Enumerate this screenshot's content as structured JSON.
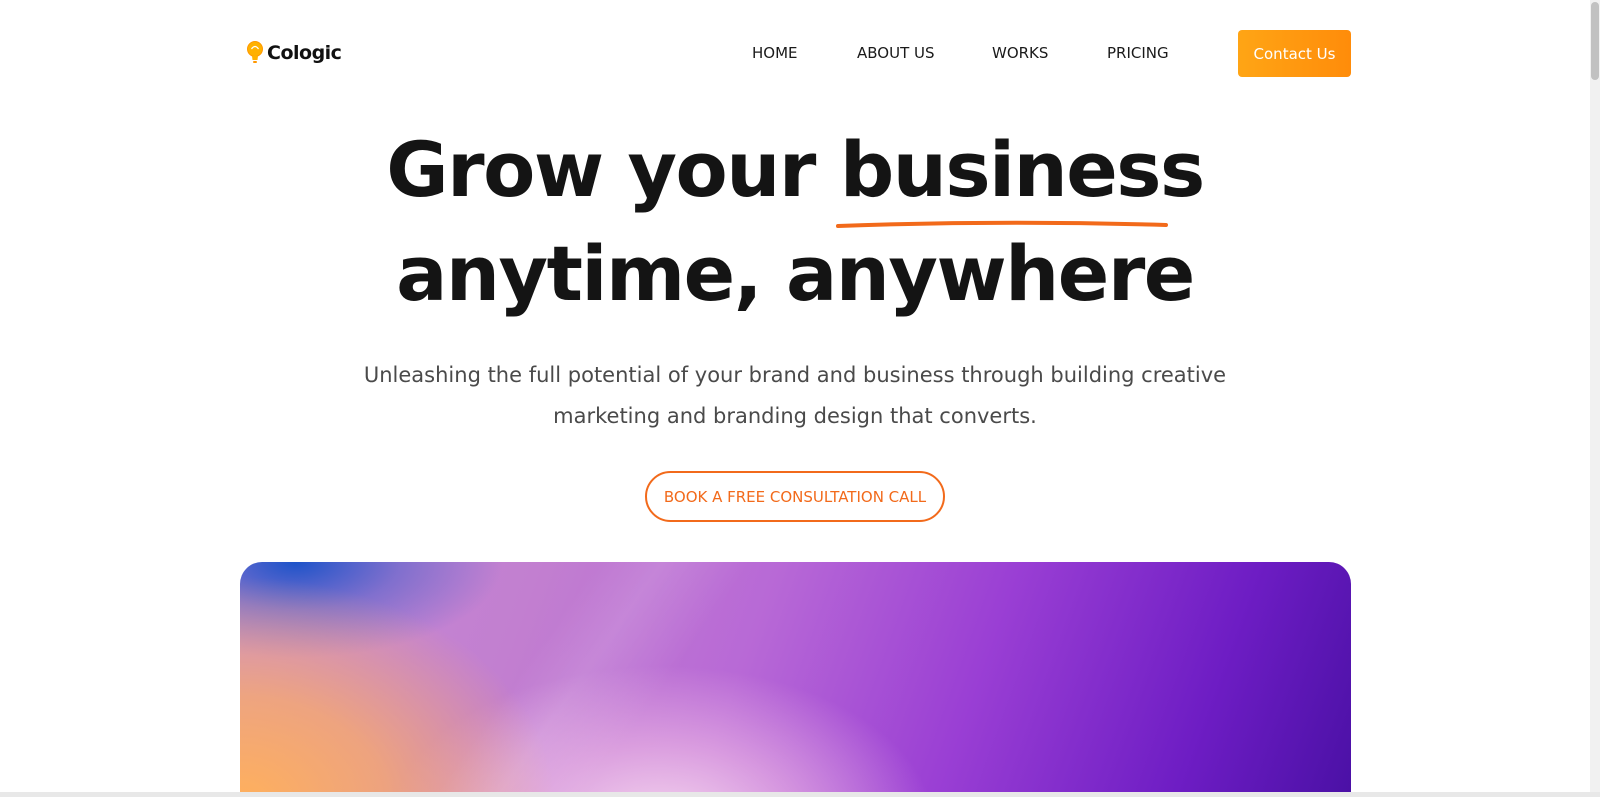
{
  "brand": {
    "name": "Cologic",
    "accent_color": "#ff8c0a",
    "icon": "lightbulb-icon"
  },
  "nav": {
    "items": [
      {
        "label": "HOME"
      },
      {
        "label": "ABOUT US"
      },
      {
        "label": "WORKS"
      },
      {
        "label": "PRICING"
      }
    ],
    "contact_label": "Contact Us"
  },
  "hero": {
    "title_part1": "Grow your ",
    "title_highlight": "business",
    "title_line2": "anytime, anywhere",
    "subtitle_line1": "Unleashing the full potential of your brand and business through building creative",
    "subtitle_line2": "marketing and branding design that converts.",
    "cta_label": "BOOK A FREE CONSULTATION CALL",
    "cta_color": "#f26a1b"
  }
}
